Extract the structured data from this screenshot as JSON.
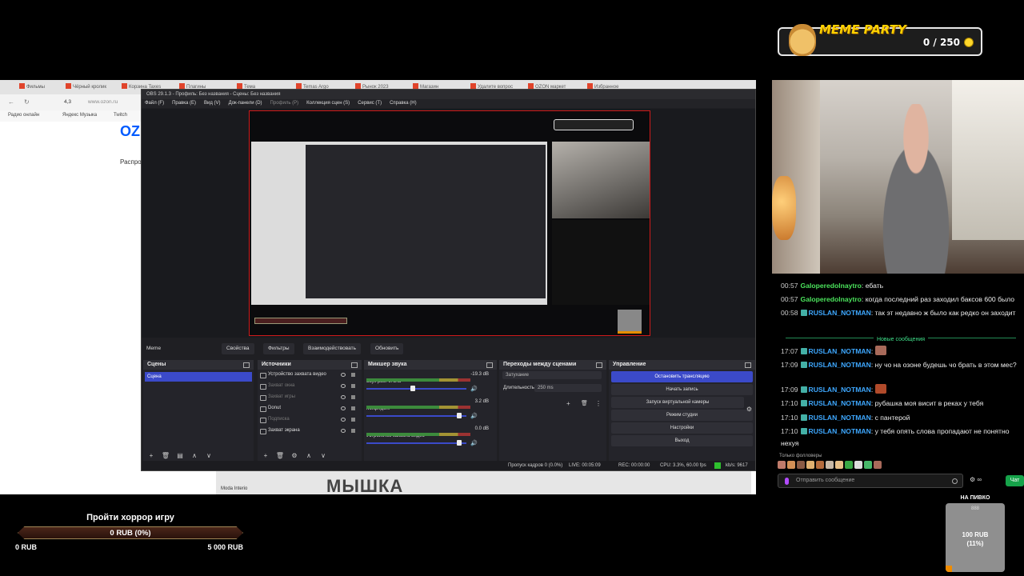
{
  "meme_widget": {
    "title": "MEME PARTY",
    "count": "0 / 250"
  },
  "browser": {
    "tabs": [
      "Фильмы",
      "Чёрный кролик",
      "Корзина Taxes",
      "Плагины",
      "Тема",
      "Temas Argo",
      "Рынок 2023",
      "Магазин",
      "Удалите вопрос",
      "OZON маркет",
      "Избранное"
    ],
    "url": "www.ozon.ru",
    "rating": "4,3",
    "bookmarks": [
      "Радио онлайн",
      "Яндекс Музыка",
      "Twitch"
    ],
    "page_logo": "OZ",
    "page_text": "Распро"
  },
  "obs": {
    "title": "OBS 29.1.3 - Профиль: Без названия - Сцены: Без названия",
    "menu": [
      "Файл (F)",
      "Правка (E)",
      "Вид (V)",
      "Док-панели (D)",
      "Профиль (P)",
      "Коллекция сцен (S)",
      "Сервис (T)",
      "Справка (H)"
    ],
    "scene_name": "Meme",
    "toolbar": [
      "Свойства",
      "Фильтры",
      "Взаимодействовать",
      "Обновить"
    ],
    "docks": {
      "scenes": {
        "title": "Сцены",
        "items": [
          "Сцена"
        ]
      },
      "sources": {
        "title": "Источники",
        "items": [
          {
            "label": "Устройство захвата видео",
            "dim": false
          },
          {
            "label": "Захват окна",
            "dim": true
          },
          {
            "label": "Захват игры",
            "dim": true
          },
          {
            "label": "Donut",
            "dim": false
          },
          {
            "label": "Подписка",
            "dim": true
          },
          {
            "label": "Захват экрана",
            "dim": false
          }
        ]
      },
      "mixer": {
        "title": "Микшер звука",
        "channels": [
          {
            "name": "Звук раб. стола",
            "db": "-19.3 dB",
            "level": 0.4
          },
          {
            "name": "Микр./доп.",
            "db": "3.2 dB",
            "level": 0.9
          },
          {
            "name": "Устройство захвата видео",
            "db": "0.0 dB",
            "level": 0.9
          }
        ]
      },
      "transitions": {
        "title": "Переходы между сценами",
        "type": "Затухание",
        "duration_label": "Длительность",
        "duration": "250 ms"
      },
      "controls": {
        "title": "Управление",
        "buttons": [
          "Остановить трансляцию",
          "Начать запись",
          "Запуск виртуальной камеры",
          "Режим студии",
          "Настройки",
          "Выход"
        ]
      }
    },
    "status": {
      "dropped": "Пропуск кадров 0 (0.0%)",
      "live": "LIVE: 00:05:09",
      "rec": "REC: 00:00:00",
      "cpu": "CPU: 3.3%, 60.00 fps",
      "kbps": "kb/s: 9617"
    }
  },
  "desktop_strip": {
    "moda": "Moda Interio",
    "banner": "МЫШКА"
  },
  "chat": {
    "messages": [
      {
        "time": "00:57",
        "user": "Galoperedolnaytro",
        "color": "#4be35c",
        "badge": false,
        "text": "ебать"
      },
      {
        "time": "00:57",
        "user": "Galoperedolnaytro",
        "color": "#4be35c",
        "badge": false,
        "text": "когда последний раз заходил баксов 600 было"
      },
      {
        "time": "00:58",
        "user": "RUSLAN_NOTMAN",
        "color": "#3ea8ff",
        "badge": true,
        "text": "так эт недавно ж было как редко он заходит"
      },
      {
        "time": "17:07",
        "user": "RUSLAN_NOTMAN",
        "color": "#3ea8ff",
        "badge": true,
        "text": ""
      },
      {
        "time": "17:09",
        "user": "RUSLAN_NOTMAN",
        "color": "#3ea8ff",
        "badge": true,
        "text": "ну чо на озоне будешь чо брать в этом мес?"
      },
      {
        "time": "17:09",
        "user": "RUSLAN_NOTMAN",
        "color": "#3ea8ff",
        "badge": true,
        "text": ""
      },
      {
        "time": "17:10",
        "user": "RUSLAN_NOTMAN",
        "color": "#3ea8ff",
        "badge": true,
        "text": "рубашка моя висит в реках у тебя"
      },
      {
        "time": "17:10",
        "user": "RUSLAN_NOTMAN",
        "color": "#3ea8ff",
        "badge": true,
        "text": "с пантерой"
      },
      {
        "time": "17:10",
        "user": "RUSLAN_NOTMAN",
        "color": "#3ea8ff",
        "badge": true,
        "text": "у тебя опять слова пропадают не понятно нехуя"
      }
    ],
    "new_messages_label": "Новые сообщения",
    "followers_only": "Только фолловеры",
    "input_placeholder": "Отправить сообщение",
    "points": "∞",
    "send_label": "Чат"
  },
  "goal": {
    "title": "Пройти хоррор игру",
    "value": "0 RUB (0%)",
    "min": "0 RUB",
    "max": "5 000 RUB",
    "progress": 0
  },
  "beer": {
    "title": "НА ПИВКО",
    "pic": "888",
    "amount": "100 RUB",
    "percent": "(11%)",
    "progress": 0.11
  }
}
